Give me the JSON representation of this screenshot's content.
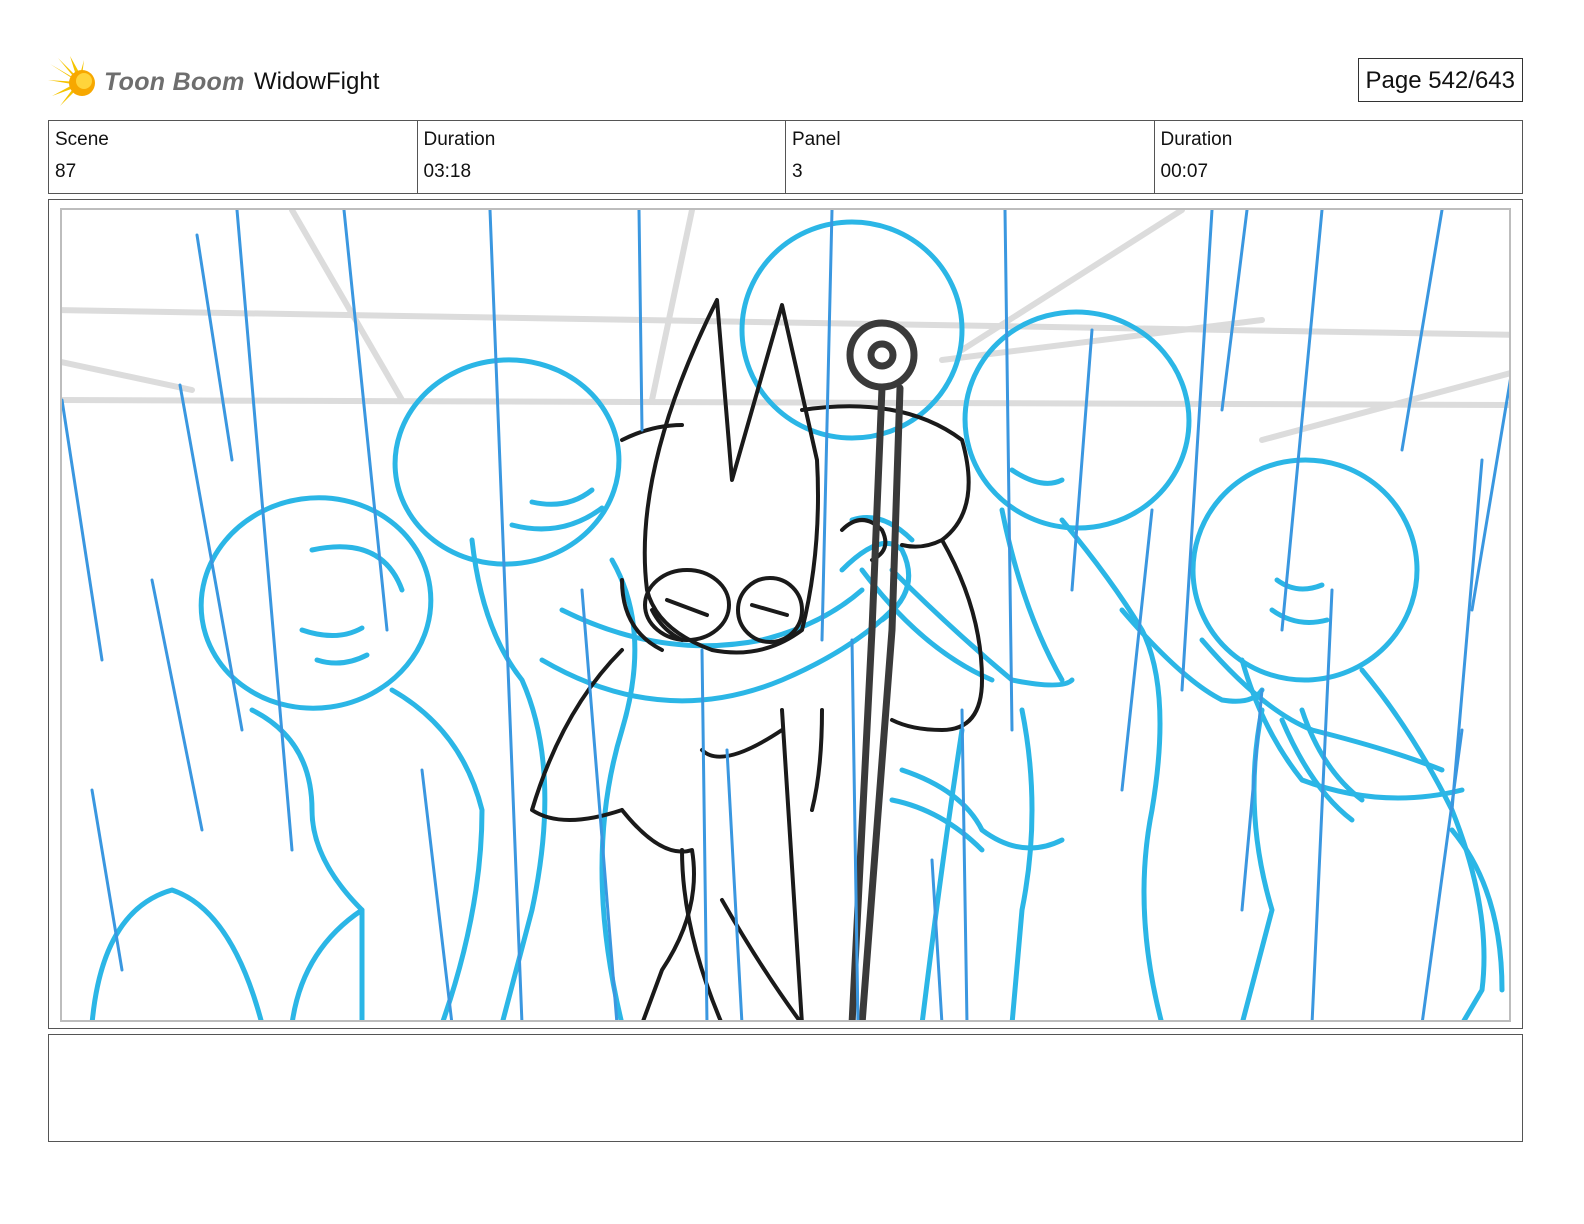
{
  "header": {
    "logo_text": "Toon Boom",
    "project_name": "WidowFight",
    "page_label": "Page 542/643"
  },
  "info": {
    "scene_label": "Scene",
    "scene_value": "87",
    "scene_duration_label": "Duration",
    "scene_duration_value": "03:18",
    "panel_label": "Panel",
    "panel_value": "3",
    "panel_duration_label": "Duration",
    "panel_duration_value": "00:07"
  },
  "icons": {
    "logo": "toon-boom-sun-icon"
  },
  "colors": {
    "sketch_blue": "#2bb6e6",
    "rain_blue": "#3a97e0",
    "ink": "#1a1a1a",
    "guide_gray": "#dcdcdc",
    "logo_yellow": "#f5c400"
  },
  "notes": {
    "text": ""
  }
}
